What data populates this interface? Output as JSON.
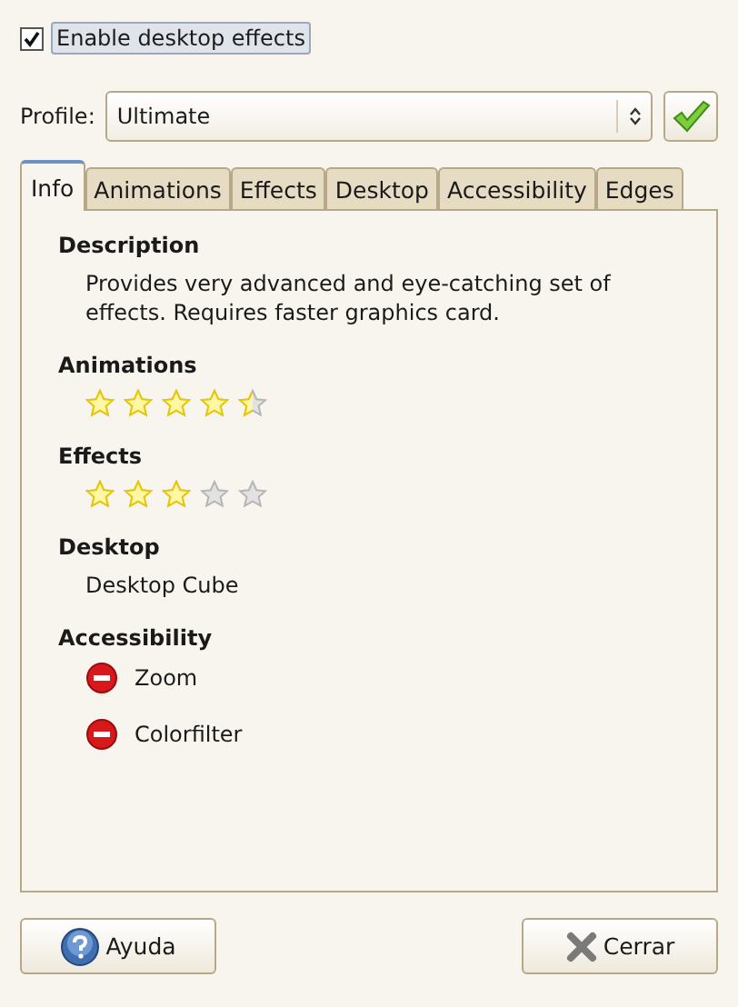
{
  "enable_effects": {
    "label": "Enable desktop effects",
    "checked": true
  },
  "profile": {
    "label": "Profile:",
    "value": "Ultimate"
  },
  "tabs": [
    {
      "label": "Info",
      "selected": true
    },
    {
      "label": "Animations",
      "selected": false
    },
    {
      "label": "Effects",
      "selected": false
    },
    {
      "label": "Desktop",
      "selected": false
    },
    {
      "label": "Accessibility",
      "selected": false
    },
    {
      "label": "Edges",
      "selected": false
    }
  ],
  "info": {
    "description": {
      "heading": "Description",
      "text": "Provides very advanced and eye-catching set of effects. Requires faster graphics card."
    },
    "animations": {
      "heading": "Animations",
      "stars": 4.5
    },
    "effects": {
      "heading": "Effects",
      "stars": 3
    },
    "desktop": {
      "heading": "Desktop",
      "text": "Desktop Cube"
    },
    "accessibility": {
      "heading": "Accessibility",
      "items": [
        {
          "label": "Zoom",
          "enabled": false
        },
        {
          "label": "Colorfilter",
          "enabled": false
        }
      ]
    }
  },
  "buttons": [
    {
      "kind": "help",
      "label": "Ayuda"
    },
    {
      "kind": "close",
      "label": "Cerrar"
    }
  ]
}
